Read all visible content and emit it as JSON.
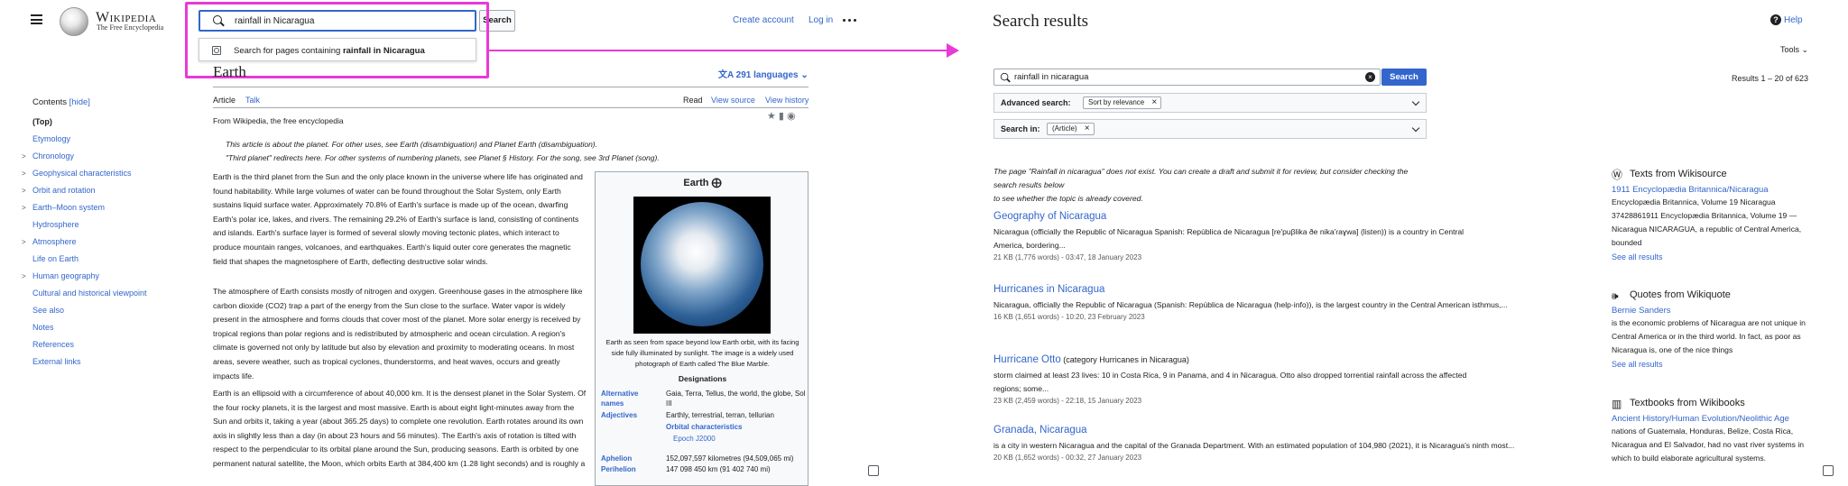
{
  "wiki": {
    "wordmark": "Wikipedia",
    "tagline": "The Free Encyclopedia",
    "search_query": "rainfall in Nicaragua",
    "search_button": "Search",
    "suggestion_prefix": "Search for pages containing",
    "suggestion_bold": "rainfall in Nicaragua",
    "create_account": "Create account",
    "log_in": "Log in"
  },
  "article": {
    "title": "Earth",
    "languages": "291 languages",
    "tab_article": "Article",
    "tab_talk": "Talk",
    "tab_read": "Read",
    "tab_view_source": "View source",
    "tab_view_history": "View history",
    "from": "From Wikipedia, the free encyclopedia",
    "hatnote1": "This article is about the planet. For other uses, see Earth (disambiguation) and Planet Earth (disambiguation).",
    "hatnote2": "\"Third planet\" redirects here. For other systems of numbering planets, see Planet § History. For the song, see 3rd Planet (song).",
    "para1": "Earth is the third planet from the Sun and the only place known in the universe where life has originated and found habitability. While large volumes of water can be found throughout the Solar System, only Earth sustains liquid surface water. Approximately 70.8% of Earth's surface is made up of the ocean, dwarfing Earth's polar ice, lakes, and rivers. The remaining 29.2% of Earth's surface is land, consisting of continents and islands. Earth's surface layer is formed of several slowly moving tectonic plates, which interact to produce mountain ranges, volcanoes, and earthquakes. Earth's liquid outer core generates the magnetic field that shapes the magnetosphere of Earth, deflecting destructive solar winds.",
    "para2": "The atmosphere of Earth consists mostly of nitrogen and oxygen. Greenhouse gases in the atmosphere like carbon dioxide (CO2) trap a part of the energy from the Sun close to the surface. Water vapor is widely present in the atmosphere and forms clouds that cover most of the planet. More solar energy is received by tropical regions than polar regions and is redistributed by atmospheric and ocean circulation. A region's climate is governed not only by latitude but also by elevation and proximity to moderating oceans. In most areas, severe weather, such as tropical cyclones, thunderstorms, and heat waves, occurs and greatly impacts life.",
    "para3": "Earth is an ellipsoid with a circumference of about 40,000 km. It is the densest planet in the Solar System. Of the four rocky planets, it is the largest and most massive. Earth is about eight light-minutes away from the Sun and orbits it, taking a year (about 365.25 days) to complete one revolution. Earth rotates around its own axis in slightly less than a day (in about 23 hours and 56 minutes). The Earth's axis of rotation is tilted with respect to the perpendicular to its orbital plane around the Sun, producing seasons. Earth is orbited by one permanent natural satellite, the Moon, which orbits Earth at 384,400 km (1.28 light seconds) and is roughly a"
  },
  "toc": {
    "title": "Contents",
    "hide": "[hide]",
    "items": [
      {
        "label": "(Top)",
        "chev": ""
      },
      {
        "label": "Etymology",
        "chev": ""
      },
      {
        "label": "Chronology",
        "chev": ">"
      },
      {
        "label": "Geophysical characteristics",
        "chev": ">"
      },
      {
        "label": "Orbit and rotation",
        "chev": ">"
      },
      {
        "label": "Earth–Moon system",
        "chev": ">"
      },
      {
        "label": "Hydrosphere",
        "chev": ""
      },
      {
        "label": "Atmosphere",
        "chev": ">"
      },
      {
        "label": "Life on Earth",
        "chev": ""
      },
      {
        "label": "Human geography",
        "chev": ">"
      },
      {
        "label": "Cultural and historical viewpoint",
        "chev": ""
      },
      {
        "label": "See also",
        "chev": ""
      },
      {
        "label": "Notes",
        "chev": ""
      },
      {
        "label": "References",
        "chev": ""
      },
      {
        "label": "External links",
        "chev": ""
      }
    ]
  },
  "infobox": {
    "title": "Earth",
    "caption": "Earth as seen from space beyond low Earth orbit, with its facing side fully illuminated by sunlight. The image is a widely used photograph of Earth called The Blue Marble.",
    "designations": "Designations",
    "rows": [
      {
        "k": "Alternative names",
        "v": "Gaia, Terra, Tellus, the world, the globe, Sol III"
      },
      {
        "k": "Adjectives",
        "v": "Earthly, terrestrial, terran, tellurian"
      },
      {
        "k": "",
        "v": "Orbital characteristics"
      },
      {
        "k": "",
        "v": "Epoch J2000"
      },
      {
        "k": "Aphelion",
        "v": "152,097,597 kilometres (94,509,065 mi)"
      },
      {
        "k": "Perihelion",
        "v": "147 098 450 km (91 402 740 mi)"
      }
    ]
  },
  "search": {
    "title": "Search results",
    "help": "Help",
    "tools": "Tools",
    "query": "rainfall in nicaragua",
    "button": "Search",
    "count": "Results 1 – 20 of 623",
    "adv_label": "Advanced search:",
    "adv_chip": "Sort by relevance",
    "in_label": "Search in:",
    "in_chip": "(Article)",
    "notice_1": "The page \"Rainfall in nicaragua\" does not exist. You can create a draft and submit it for review, but consider checking the search results below",
    "notice_2": "to see whether the topic is already covered.",
    "results": [
      {
        "title": "Geography of Nicaragua",
        "snippet": "Nicaragua (officially the Republic of Nicaragua Spanish: República de Nicaragua [re'puβlika ðe nika'ɾaɣwa] (listen)) is a country in Central America, bordering...",
        "meta": "21 KB (1,776 words) - 03:47, 18 January 2023"
      },
      {
        "title": "Hurricanes in Nicaragua",
        "snippet": "Nicaragua, officially the Republic of Nicaragua (Spanish: República de Nicaragua (help·info)), is the largest country in the Central American isthmus,...",
        "meta": "16 KB (1,651 words) - 10:20, 23 February 2023"
      },
      {
        "title": "Hurricane Otto",
        "category": "(category Hurricanes in Nicaragua)",
        "snippet": "storm claimed at least 23 lives: 10 in Costa Rica, 9 in Panama, and 4 in Nicaragua. Otto also dropped torrential rainfall across the affected regions; some...",
        "meta": "23 KB (2,459 words) - 22:18, 15 January 2023"
      },
      {
        "title": "Granada, Nicaragua",
        "snippet": "is a city in western Nicaragua and the capital of the Granada Department. With an estimated population of 104,980 (2021), it is Nicaragua's ninth most...",
        "meta": "20 KB (1,652 words) - 00:32, 27 January 2023"
      }
    ],
    "side": [
      {
        "head": "Texts from Wikisource",
        "link": "1911 Encyclopædia Britannica/Nicaragua",
        "text": "Encyclopædia Britannica, Volume 19 Nicaragua 37428861911 Encyclopædia Britannica, Volume 19 — Nicaragua NICARAGUA, a republic of Central America, bounded",
        "see": "See all results"
      },
      {
        "head": "Quotes from Wikiquote",
        "link": "Bernie Sanders",
        "text": "is the economic problems of Nicaragua are not unique in Central America or in the third world. In fact, as poor as Nicaragua is, one of the nice things",
        "see": "See all results"
      },
      {
        "head": "Textbooks from Wikibooks",
        "link": "Ancient History/Human Evolution/Neolithic Age",
        "text": "nations of Guatemala, Honduras, Belize, Costa Rica, Nicaragua and El Salvador, had no vast river systems in which to build elaborate agricultural systems.",
        "see": ""
      }
    ]
  }
}
